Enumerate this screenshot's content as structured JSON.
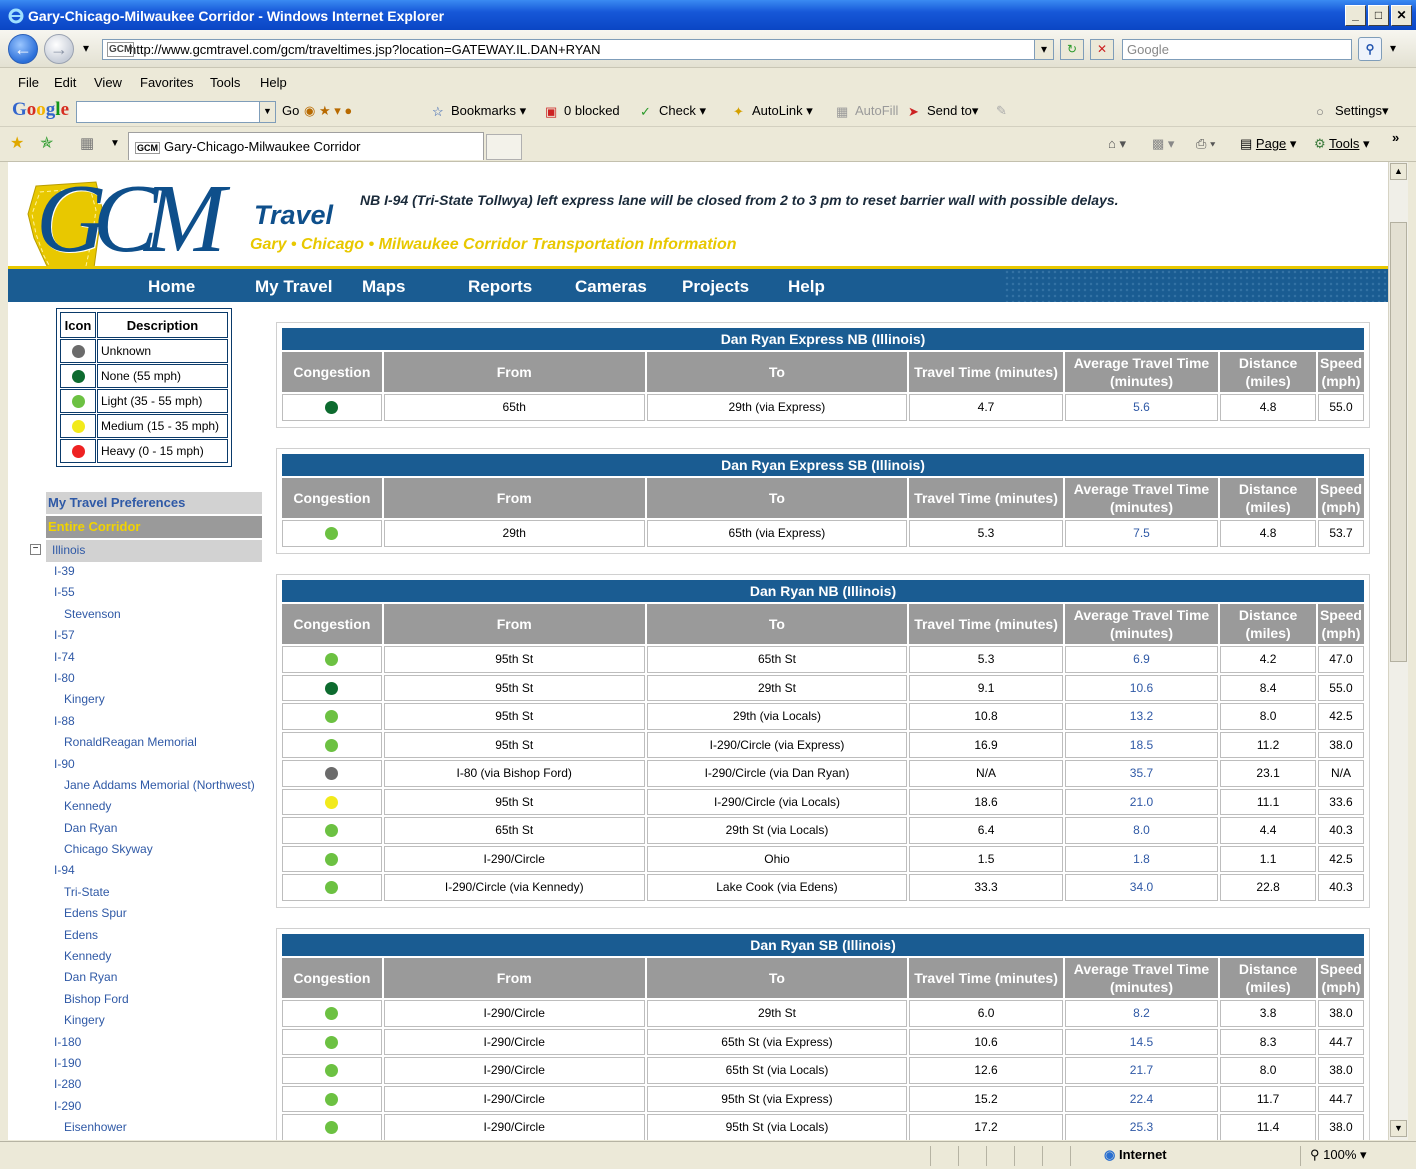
{
  "window": {
    "title": "Gary-Chicago-Milwaukee Corridor - Windows Internet Explorer",
    "url": "http://www.gcmtravel.com/gcm/traveltimes.jsp?location=GATEWAY.IL.DAN+RYAN",
    "search_placeholder": "Google",
    "tab_title": "Gary-Chicago-Milwaukee Corridor",
    "favicon_text": "GCM"
  },
  "menu": [
    "File",
    "Edit",
    "View",
    "Favorites",
    "Tools",
    "Help"
  ],
  "google_toolbar": {
    "logo": [
      "G",
      "o",
      "o",
      "g",
      "l",
      "e"
    ],
    "go": "Go",
    "bookmarks": "Bookmarks",
    "blocked": "0 blocked",
    "check": "Check",
    "autolink": "AutoLink",
    "autofill": "AutoFill",
    "sendto": "Send to",
    "settings": "Settings"
  },
  "tab_toolbar": {
    "page": "Page",
    "tools": "Tools"
  },
  "status": {
    "zone": "Internet",
    "zoom": "100%"
  },
  "site": {
    "logo_gcm": "GCM",
    "logo_travel": "Travel",
    "tagline": "Gary • Chicago • Milwaukee Corridor Transportation Information",
    "alert": "NB I-94 (Tri-State Tollwya) left express lane will be closed from 2 to 3 pm to reset barrier wall with possible delays.",
    "nav": [
      "Home",
      "My Travel",
      "Maps",
      "Reports",
      "Cameras",
      "Projects",
      "Help"
    ]
  },
  "legend": {
    "headers": [
      "Icon",
      "Description"
    ],
    "items": [
      {
        "color": "#6b6b6b",
        "label": "Unknown"
      },
      {
        "color": "#0d6b2f",
        "label": "None (55 mph)"
      },
      {
        "color": "#6cc142",
        "label": "Light (35 - 55 mph)"
      },
      {
        "color": "#f2ea1b",
        "label": "Medium (15 - 35 mph)"
      },
      {
        "color": "#ee2222",
        "label": "Heavy (0 - 15 mph)"
      }
    ]
  },
  "sidebar": {
    "preferences": "My Travel Preferences",
    "entire_corridor": "Entire Corridor",
    "illinois": "Illinois",
    "tree": [
      {
        "label": "I-39",
        "level": 1
      },
      {
        "label": "I-55",
        "level": 1
      },
      {
        "label": "Stevenson",
        "level": 2
      },
      {
        "label": "I-57",
        "level": 1
      },
      {
        "label": "I-74",
        "level": 1
      },
      {
        "label": "I-80",
        "level": 1
      },
      {
        "label": "Kingery",
        "level": 2
      },
      {
        "label": "I-88",
        "level": 1
      },
      {
        "label": "RonaldReagan Memorial",
        "level": 2
      },
      {
        "label": "I-90",
        "level": 1
      },
      {
        "label": "Jane Addams Memorial (Northwest)",
        "level": 2
      },
      {
        "label": "Kennedy",
        "level": 2
      },
      {
        "label": "Dan Ryan",
        "level": 2
      },
      {
        "label": "Chicago Skyway",
        "level": 2
      },
      {
        "label": "I-94",
        "level": 1
      },
      {
        "label": "Tri-State",
        "level": 2
      },
      {
        "label": "Edens Spur",
        "level": 2
      },
      {
        "label": "Edens",
        "level": 2
      },
      {
        "label": "Kennedy",
        "level": 2
      },
      {
        "label": "Dan Ryan",
        "level": 2
      },
      {
        "label": "Bishop Ford",
        "level": 2
      },
      {
        "label": "Kingery",
        "level": 2
      },
      {
        "label": "I-180",
        "level": 1
      },
      {
        "label": "I-190",
        "level": 1
      },
      {
        "label": "I-280",
        "level": 1
      },
      {
        "label": "I-290",
        "level": 1
      },
      {
        "label": "Eisenhower",
        "level": 2
      }
    ]
  },
  "columns": [
    "Congestion",
    "From",
    "To",
    "Travel Time (minutes)",
    "Average Travel Time (minutes)",
    "Distance (miles)",
    "Speed (mph)"
  ],
  "tables": [
    {
      "title": "Dan Ryan Express NB (Illinois)",
      "rows": [
        {
          "status": "#0d6b2f",
          "from": "65th",
          "to": "29th (via Express)",
          "time": "4.7",
          "avg": "5.6",
          "dist": "4.8",
          "speed": "55.0"
        }
      ]
    },
    {
      "title": "Dan Ryan Express SB (Illinois)",
      "rows": [
        {
          "status": "#6cc142",
          "from": "29th",
          "to": "65th (via Express)",
          "time": "5.3",
          "avg": "7.5",
          "dist": "4.8",
          "speed": "53.7"
        }
      ]
    },
    {
      "title": "Dan Ryan NB (Illinois)",
      "rows": [
        {
          "status": "#6cc142",
          "from": "95th St",
          "to": "65th St",
          "time": "5.3",
          "avg": "6.9",
          "dist": "4.2",
          "speed": "47.0"
        },
        {
          "status": "#0d6b2f",
          "from": "95th St",
          "to": "29th St",
          "time": "9.1",
          "avg": "10.6",
          "dist": "8.4",
          "speed": "55.0"
        },
        {
          "status": "#6cc142",
          "from": "95th St",
          "to": "29th (via Locals)",
          "time": "10.8",
          "avg": "13.2",
          "dist": "8.0",
          "speed": "42.5"
        },
        {
          "status": "#6cc142",
          "from": "95th St",
          "to": "I-290/Circle (via Express)",
          "time": "16.9",
          "avg": "18.5",
          "dist": "11.2",
          "speed": "38.0"
        },
        {
          "status": "#6b6b6b",
          "from": "I-80 (via Bishop Ford)",
          "to": "I-290/Circle (via Dan Ryan)",
          "time": "N/A",
          "avg": "35.7",
          "dist": "23.1",
          "speed": "N/A"
        },
        {
          "status": "#f2ea1b",
          "from": "95th St",
          "to": "I-290/Circle (via Locals)",
          "time": "18.6",
          "avg": "21.0",
          "dist": "11.1",
          "speed": "33.6"
        },
        {
          "status": "#6cc142",
          "from": "65th St",
          "to": "29th St (via Locals)",
          "time": "6.4",
          "avg": "8.0",
          "dist": "4.4",
          "speed": "40.3"
        },
        {
          "status": "#6cc142",
          "from": "I-290/Circle",
          "to": "Ohio",
          "time": "1.5",
          "avg": "1.8",
          "dist": "1.1",
          "speed": "42.5"
        },
        {
          "status": "#6cc142",
          "from": "I-290/Circle (via Kennedy)",
          "to": "Lake Cook (via Edens)",
          "time": "33.3",
          "avg": "34.0",
          "dist": "22.8",
          "speed": "40.3"
        }
      ]
    },
    {
      "title": "Dan Ryan SB (Illinois)",
      "rows": [
        {
          "status": "#6cc142",
          "from": "I-290/Circle",
          "to": "29th St",
          "time": "6.0",
          "avg": "8.2",
          "dist": "3.8",
          "speed": "38.0"
        },
        {
          "status": "#6cc142",
          "from": "I-290/Circle",
          "to": "65th St (via Express)",
          "time": "10.6",
          "avg": "14.5",
          "dist": "8.3",
          "speed": "44.7"
        },
        {
          "status": "#6cc142",
          "from": "I-290/Circle",
          "to": "65th St (via Locals)",
          "time": "12.6",
          "avg": "21.7",
          "dist": "8.0",
          "speed": "38.0"
        },
        {
          "status": "#6cc142",
          "from": "I-290/Circle",
          "to": "95th St (via Express)",
          "time": "15.2",
          "avg": "22.4",
          "dist": "11.7",
          "speed": "44.7"
        },
        {
          "status": "#6cc142",
          "from": "I-290/Circle",
          "to": "95th St (via Locals)",
          "time": "17.2",
          "avg": "25.3",
          "dist": "11.4",
          "speed": "38.0"
        }
      ]
    }
  ]
}
